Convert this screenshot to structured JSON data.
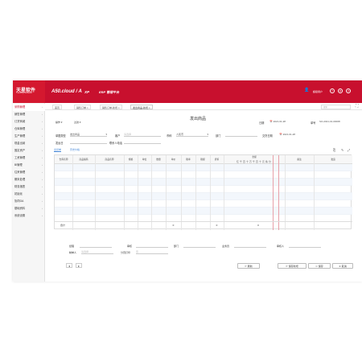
{
  "brand": {
    "logo": "天星软件",
    "sub": "Tianxing Software"
  },
  "header": {
    "app_name": "A50.cloud / A",
    "xp": "XP",
    "platform": "ERP 管理平台",
    "user": "超级用户"
  },
  "sidebar": {
    "items": [
      {
        "label": "采购管理"
      },
      {
        "label": "销售管理"
      },
      {
        "label": "订货商城"
      },
      {
        "label": "仓库管理"
      },
      {
        "label": "生产管理"
      },
      {
        "label": "现金出纳"
      },
      {
        "label": "固定资产"
      },
      {
        "label": "工资管理"
      },
      {
        "label": "BI管理"
      },
      {
        "label": "往来管理"
      },
      {
        "label": "期末处理"
      },
      {
        "label": "财务报表"
      },
      {
        "label": "初始化"
      },
      {
        "label": "协同OA"
      },
      {
        "label": "基础资料"
      },
      {
        "label": "系统设置"
      }
    ]
  },
  "tabs": [
    {
      "label": "首页"
    },
    {
      "label": "销售订单"
    },
    {
      "label": "销售订单-新增"
    },
    {
      "label": "发出商品-新增"
    }
  ],
  "tab_search": {
    "placeholder": "搜索"
  },
  "form": {
    "title": "发出商品",
    "btn_ops": "操作",
    "btn_filter": "过滤",
    "date_label": "日期",
    "date_value": "2021-01-28",
    "no_label": "单号",
    "no_value": "SO-2021-01-00008",
    "type_label": "单据类型",
    "type_value": "发出商品",
    "customer_label": "客户",
    "customer_placeholder": "请选择",
    "currency_label": "币种",
    "currency_value": "人民币",
    "dept_label": "部门",
    "agreed_date_label": "交货日期",
    "agreed_date_value": "2021-01-28",
    "dept2_label": "发运日",
    "contact_label": "联系人电话"
  },
  "subtabs": [
    {
      "label": "出货单"
    },
    {
      "label": "历史价格"
    }
  ],
  "grid": {
    "columns": [
      {
        "label": "仓库名称"
      },
      {
        "label": "商品编码"
      },
      {
        "label": "商品名称"
      },
      {
        "label": "规格"
      },
      {
        "label": "单位"
      },
      {
        "label": "数量"
      },
      {
        "label": "单价"
      },
      {
        "label": "税率"
      },
      {
        "label": "税额"
      },
      {
        "label": "折扣"
      },
      {
        "label": "金额"
      },
      {
        "label": "备注"
      },
      {
        "label": "发运"
      }
    ],
    "amount_units": "亿千百十万千百十元角分",
    "footer": {
      "label": "合计",
      "qty": "0",
      "tax": "0",
      "amount": "0"
    }
  },
  "bottom": {
    "manager_label": "经理",
    "reviewer_label": "审核",
    "dept_label": "部门",
    "checker_label": "业务员",
    "auditor_label": "审核人",
    "maker_label": "制单人",
    "maker_placeholder": "请选择",
    "print_label": "分页打印",
    "print_placeholder": "否"
  },
  "actions": {
    "prev": "◂",
    "next": "▸",
    "refresh": "刷新",
    "save_new": "保存新增",
    "save": "保存",
    "cancel": "取消"
  }
}
